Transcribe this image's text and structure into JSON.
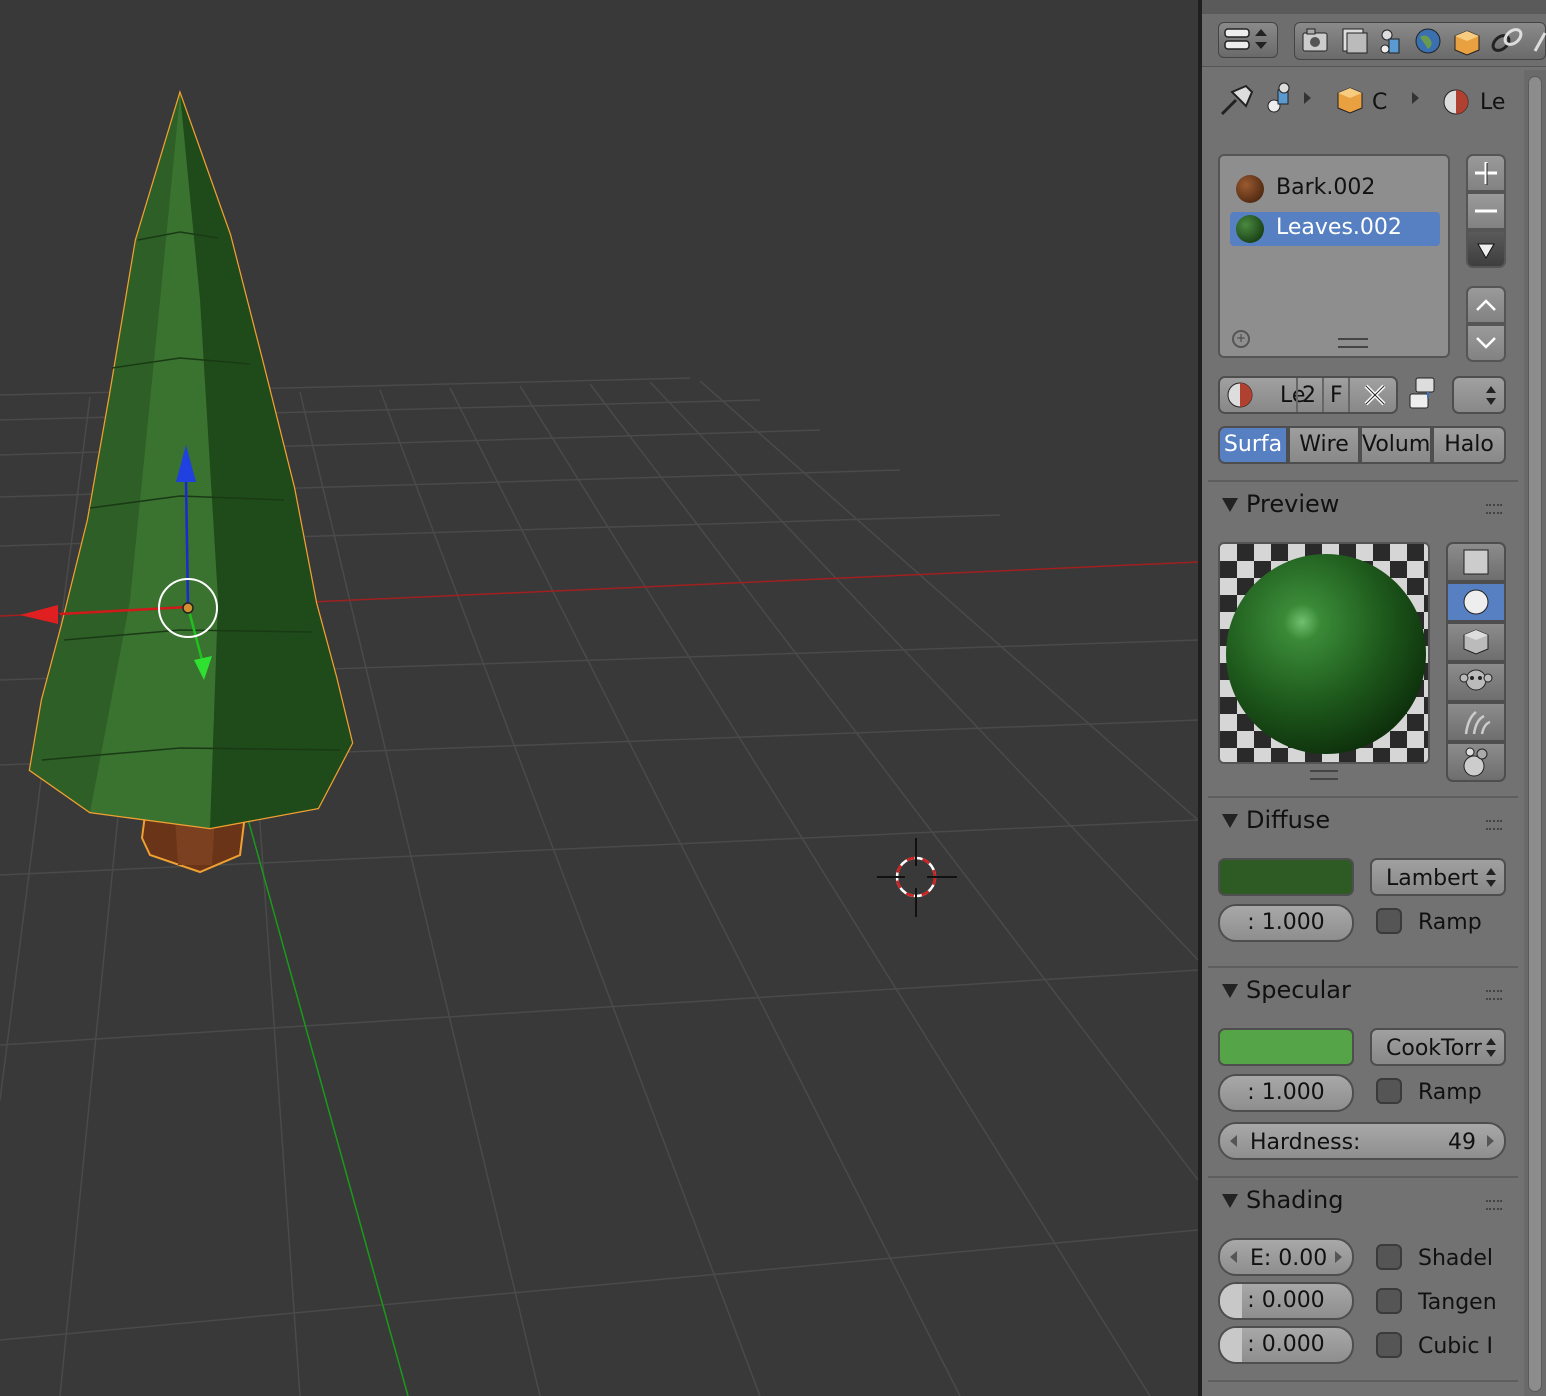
{
  "materials": {
    "slots": [
      {
        "label": "Bark.002",
        "color": "#5a2f16",
        "selected": false
      },
      {
        "label": "Leaves.002",
        "color": "#1e4a1e",
        "selected": true
      }
    ]
  },
  "breadcrumb": {
    "object_label": "C",
    "material_label": "Le"
  },
  "datablock": {
    "name": "Le",
    "users": "2",
    "fake": "F"
  },
  "material_types": [
    "Surfa",
    "Wire",
    "Volum",
    "Halo"
  ],
  "preview": {
    "title": "Preview",
    "shapes": [
      "flat-icon",
      "sphere-icon",
      "cube-icon",
      "monkey-icon",
      "hair-icon",
      "sky-icon"
    ]
  },
  "diffuse": {
    "title": "Diffuse",
    "color": "#2e5a24",
    "shader": "Lambert",
    "intensity": ": 1.000",
    "ramp_label": "Ramp"
  },
  "specular": {
    "title": "Specular",
    "color": "#55a548",
    "shader": "CookTorr",
    "intensity": ": 1.000",
    "ramp_label": "Ramp",
    "hardness_label": "Hardness:",
    "hardness_value": "49"
  },
  "shading": {
    "title": "Shading",
    "emit": "E: 0.00",
    "ambient": ": 0.000",
    "translucency": ": 0.000",
    "shadeless_label": "Shadel",
    "tangent_label": "Tangen",
    "cubic_label": "Cubic I"
  }
}
